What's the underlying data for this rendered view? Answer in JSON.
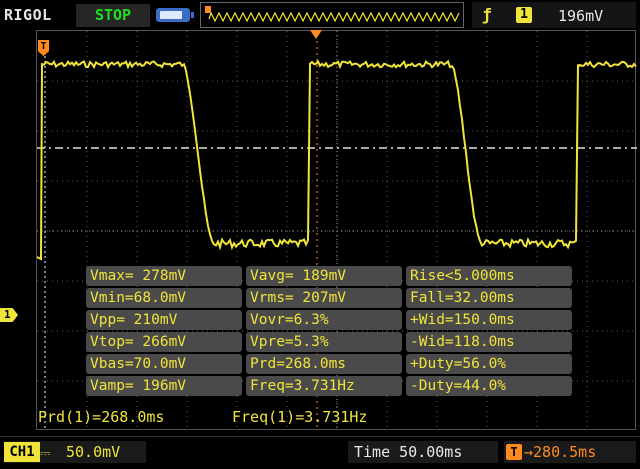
{
  "brand": "RIGOL",
  "run_status": "STOP",
  "trigger": {
    "edge_icon": "rising-edge-icon",
    "source": "1",
    "level": "196mV"
  },
  "channel_marker": "1",
  "trigger_pos_marker": "T",
  "measurements": [
    [
      "Vmax= 278mV",
      "Vavg= 189mV",
      "Rise<5.000ms"
    ],
    [
      "Vmin=68.0mV",
      "Vrms= 207mV",
      "Fall=32.00ms"
    ],
    [
      "Vpp= 210mV",
      "Vovr=6.3%",
      "+Wid=150.0ms"
    ],
    [
      "Vtop= 266mV",
      "Vpre=5.3%",
      "-Wid=118.0ms"
    ],
    [
      "Vbas=70.0mV",
      "Prd=268.0ms",
      "+Duty=56.0%"
    ],
    [
      "Vamp= 196mV",
      "Freq=3.731Hz",
      "-Duty=44.0%"
    ]
  ],
  "bottom_measurements": {
    "prd": "Prd(1)=268.0ms",
    "freq": "Freq(1)=3.731Hz"
  },
  "channel": {
    "name": "CH1",
    "coupling_icon": "dc-coupling-icon",
    "scale": "50.0mV"
  },
  "timebase": "Time 50.00ms",
  "trigger_offset": {
    "icon": "T",
    "value": "280.5ms"
  },
  "colors": {
    "trace": "#f0e43a",
    "accent": "#ff8a1f",
    "status": "#1fe01f"
  },
  "waveform": {
    "high_level_mV": 266,
    "low_level_mV": 70,
    "volts_per_div_mV": 50,
    "period_ms": 268.0,
    "duty_percent": 56.0,
    "fall_ms": 32.0
  }
}
